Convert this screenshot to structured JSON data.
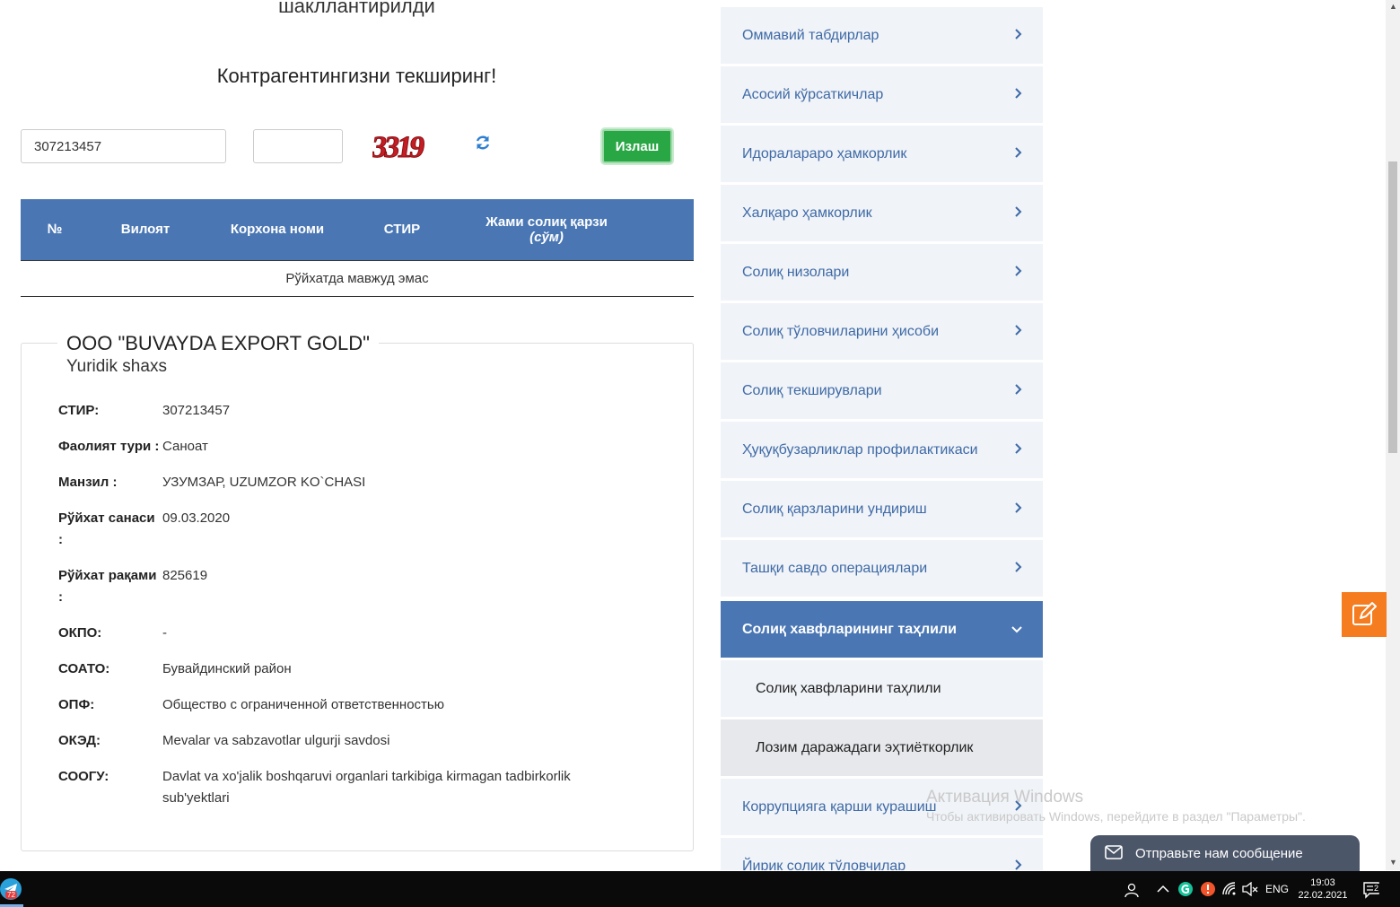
{
  "main": {
    "heading_top": "шакллантирилди",
    "heading_check": "Контрагентингизни текширинг!",
    "search": {
      "stir_value": "307213457",
      "captcha_value": "",
      "captcha_text": "3319",
      "button_label": "Излаш"
    },
    "table": {
      "headers": [
        "№",
        "Вилоят",
        "Корхона номи",
        "СТИР",
        "Жами солиқ қарзи"
      ],
      "header_sub": "(сўм)",
      "empty_text": "Рўйхатда мавжуд эмас"
    },
    "company": {
      "name": "ООО \"BUVAYDA EXPORT GOLD\"",
      "type": "Yuridik shaxs",
      "rows": [
        {
          "label": "СТИР:",
          "value": "307213457"
        },
        {
          "label": "Фаолият тури :",
          "value": "Саноат"
        },
        {
          "label": "Манзил :",
          "value": "УЗУМЗАР, UZUMZOR KO`CHASI"
        },
        {
          "label": "Рўйхат санаси :",
          "value": "09.03.2020"
        },
        {
          "label": "Рўйхат рақами :",
          "value": "825619"
        },
        {
          "label": "ОКПО:",
          "value": "-"
        },
        {
          "label": "СОАТО:",
          "value": "Бувайдинский район"
        },
        {
          "label": "ОПФ:",
          "value": "Общество с ограниченной ответственностью"
        },
        {
          "label": "ОКЭД:",
          "value": "Mevalar va sabzavotlar ulgurji savdosi"
        },
        {
          "label": "СООГУ:",
          "value": "Davlat va xo'jalik boshqaruvi organlari tarkibiga kirmagan tadbirkorlik sub'yektlari"
        }
      ]
    }
  },
  "sidebar": {
    "items": [
      {
        "label": "Оммавий табдирлар"
      },
      {
        "label": "Асосий кўрсаткичлар"
      },
      {
        "label": "Идоралараро ҳамкорлик"
      },
      {
        "label": "Халқаро ҳамкорлик"
      },
      {
        "label": "Солиқ низолари"
      },
      {
        "label": "Солиқ тўловчиларини ҳисоби"
      },
      {
        "label": "Солиқ текширувлари"
      },
      {
        "label": "Ҳуқуқбузарликлар профилактикаси"
      },
      {
        "label": "Солиқ қарзларини ундириш"
      },
      {
        "label": "Ташқи савдо операциялари"
      },
      {
        "label": "Солиқ хавфларининг таҳлили"
      }
    ],
    "subitems": [
      {
        "label": "Солиқ хавфларини таҳлили"
      },
      {
        "label": "Лозим даражадаги эҳтиёткорлик"
      }
    ],
    "after_items": [
      {
        "label": "Коррупцияга қарши курашиш"
      },
      {
        "label": "Йирик солиқ тўловчилар"
      }
    ]
  },
  "overlay": {
    "activation_title": "Активация Windows",
    "activation_text": "Чтобы активировать Windows, перейдите в раздел \"Параметры\".",
    "chat_label": "Отправьте нам сообщение"
  },
  "taskbar": {
    "telegram_badge": "72",
    "language": "ENG",
    "time": "19:03",
    "date": "22.02.2021",
    "notifications": "2"
  },
  "colors": {
    "accent_blue": "#4a77b4",
    "link_blue": "#3e6aa7",
    "button_green": "#2aa745",
    "fab_orange": "#f57c1f",
    "chat_bg": "#4c5669"
  }
}
